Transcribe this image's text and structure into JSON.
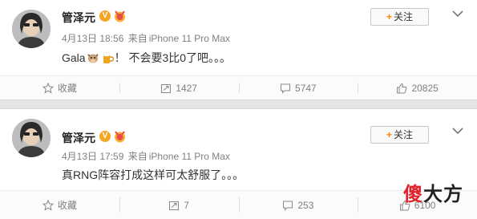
{
  "posts": [
    {
      "username": "管泽元",
      "verified_badge": "V",
      "date": "4月13日",
      "time": "18:56",
      "source_prefix": "来自",
      "device": "iPhone 11 Pro Max",
      "text_before": "Gala",
      "text_after": "！ 不会要3比0了吧。。。",
      "follow_label": "关注",
      "collect_label": "收藏",
      "reposts": "1427",
      "comments": "5747",
      "likes": "20825"
    },
    {
      "username": "管泽元",
      "verified_badge": "V",
      "date": "4月13日",
      "time": "17:59",
      "source_prefix": "来自",
      "device": "iPhone 11 Pro Max",
      "text": "真RNG阵容打成这样可太舒服了。。。",
      "follow_label": "关注",
      "collect_label": "收藏",
      "reposts": "7",
      "comments": "253",
      "likes": "6100"
    }
  ],
  "watermark": {
    "part1": "傻",
    "part2": "大方"
  },
  "colors": {
    "accent": "#ff8200",
    "verified": "#f5a623",
    "meta": "#808080"
  }
}
